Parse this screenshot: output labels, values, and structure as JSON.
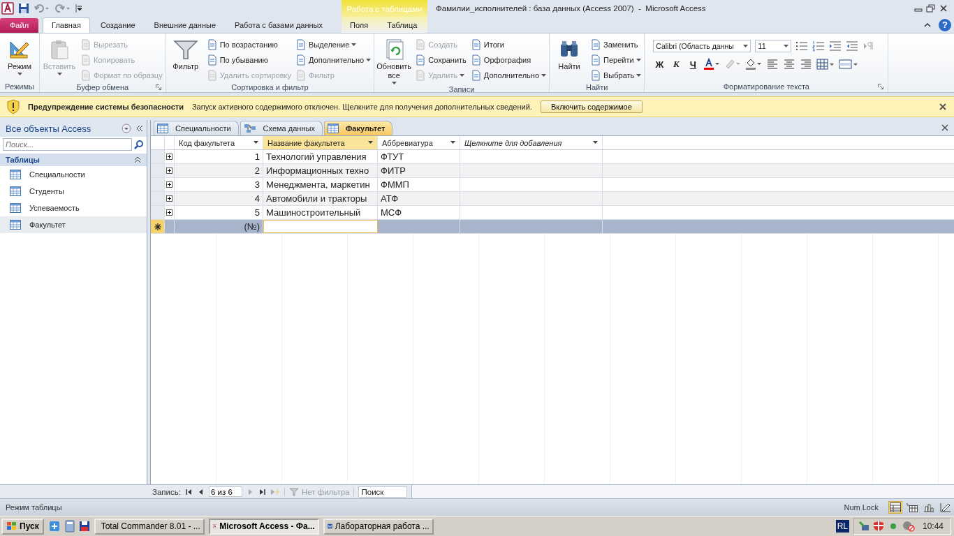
{
  "title_bar": {
    "contextual_group": "Работа с таблицами",
    "title": "Фамилии_исполнителей : база данных (Access 2007)  -  Microsoft Access"
  },
  "ribbon_tabs": [
    {
      "label": "Файл",
      "kind": "file",
      "selected": false
    },
    {
      "label": "Главная",
      "kind": "normal",
      "selected": true
    },
    {
      "label": "Создание",
      "kind": "normal",
      "selected": false
    },
    {
      "label": "Внешние данные",
      "kind": "normal",
      "selected": false
    },
    {
      "label": "Работа с базами данных",
      "kind": "normal",
      "selected": false
    },
    {
      "label": "Поля",
      "kind": "contextual",
      "selected": false
    },
    {
      "label": "Таблица",
      "kind": "contextual",
      "selected": false
    }
  ],
  "help": "?",
  "ribbon_groups": [
    {
      "kind": "commands",
      "label": "Режимы",
      "launcher": false,
      "large": {
        "label": "Режим",
        "disabled": false,
        "dropdown": true
      }
    },
    {
      "kind": "commands",
      "label": "Буфер обмена",
      "launcher": true,
      "large": {
        "label": "Вставить",
        "disabled": true,
        "dropdown": true
      },
      "columns": [
        [
          {
            "label": "Вырезать",
            "disabled": true,
            "dropdown": false
          },
          {
            "label": "Копировать",
            "disabled": true,
            "dropdown": false
          },
          {
            "label": "Формат по образцу",
            "disabled": true,
            "dropdown": false
          }
        ]
      ]
    },
    {
      "kind": "commands",
      "label": "Сортировка и фильтр",
      "launcher": false,
      "large": {
        "label": "Фильтр",
        "disabled": false,
        "dropdown": false
      },
      "columns": [
        [
          {
            "label": "По возрастанию",
            "disabled": false,
            "dropdown": false
          },
          {
            "label": "По убыванию",
            "disabled": false,
            "dropdown": false
          },
          {
            "label": "Удалить сортировку",
            "disabled": true,
            "dropdown": false
          }
        ],
        [
          {
            "label": "Выделение",
            "disabled": false,
            "dropdown": true
          },
          {
            "label": "Дополнительно",
            "disabled": false,
            "dropdown": true
          },
          {
            "label": "Фильтр",
            "disabled": true,
            "dropdown": false
          }
        ]
      ]
    },
    {
      "kind": "commands",
      "label": "Записи",
      "launcher": false,
      "large": {
        "label": "Обновить все",
        "disabled": false,
        "dropdown": true
      },
      "columns": [
        [
          {
            "label": "Создать",
            "disabled": true,
            "dropdown": false
          },
          {
            "label": "Сохранить",
            "disabled": false,
            "dropdown": false
          },
          {
            "label": "Удалить",
            "disabled": true,
            "dropdown": true
          }
        ],
        [
          {
            "label": "Итоги",
            "disabled": false,
            "dropdown": false
          },
          {
            "label": "Орфография",
            "disabled": false,
            "dropdown": false
          },
          {
            "label": "Дополнительно",
            "disabled": false,
            "dropdown": true
          }
        ]
      ]
    },
    {
      "kind": "commands",
      "label": "Найти",
      "launcher": false,
      "large": {
        "label": "Найти",
        "disabled": false,
        "dropdown": false
      },
      "columns": [
        [
          {
            "label": "Заменить",
            "disabled": false,
            "dropdown": false
          },
          {
            "label": "Перейти",
            "disabled": false,
            "dropdown": true
          },
          {
            "label": "Выбрать",
            "disabled": false,
            "dropdown": true
          }
        ]
      ]
    },
    {
      "kind": "format",
      "label": "Форматирование текста",
      "launcher": true,
      "font": "Calibri (Область данны",
      "size": "11",
      "style_buttons": [
        "Ж",
        "К",
        "Ч"
      ]
    }
  ],
  "security_bar": {
    "title": "Предупреждение системы безопасности",
    "message": "Запуск активного содержимого отключен. Щелкните для получения дополнительных сведений.",
    "button": "Включить содержимое"
  },
  "nav_pane": {
    "title": "Все объекты Access",
    "search_placeholder": "Поиск...",
    "group": "Таблицы",
    "items": [
      {
        "label": "Специальности",
        "selected": false
      },
      {
        "label": "Студенты",
        "selected": false
      },
      {
        "label": "Успеваемость",
        "selected": false
      },
      {
        "label": "Факультет",
        "selected": true
      }
    ]
  },
  "document_tabs": [
    {
      "label": "Специальности",
      "kind": "table",
      "selected": false
    },
    {
      "label": "Схема данных",
      "kind": "relationships",
      "selected": false
    },
    {
      "label": "Факультет",
      "kind": "table",
      "selected": true
    }
  ],
  "table": {
    "columns": [
      {
        "label": "Код факультета",
        "kind": "field",
        "selected": false
      },
      {
        "label": "Название факультета",
        "kind": "field",
        "selected": true
      },
      {
        "label": "Аббревиатура",
        "kind": "field",
        "selected": false
      },
      {
        "label": "Щелкните для добавления",
        "kind": "add",
        "selected": false
      }
    ],
    "rows": [
      {
        "kind": "record",
        "current": false,
        "cells": [
          "1",
          "Технологий управления",
          "ФТУТ"
        ]
      },
      {
        "kind": "record",
        "current": false,
        "cells": [
          "2",
          "Информационных техно",
          "ФИТР"
        ]
      },
      {
        "kind": "record",
        "current": false,
        "cells": [
          "3",
          "Менеджмента, маркетин",
          "ФММП"
        ]
      },
      {
        "kind": "record",
        "current": false,
        "cells": [
          "4",
          "Автомобили и тракторы",
          "АТФ"
        ]
      },
      {
        "kind": "record",
        "current": false,
        "cells": [
          "5",
          "Машиностроительный",
          "МСФ"
        ]
      },
      {
        "kind": "new",
        "current": true,
        "cells": [
          "(№)"
        ]
      }
    ]
  },
  "record_nav": {
    "label": "Запись:",
    "position": "6 из 6",
    "filter": "Нет фильтра",
    "search_placeholder": "Поиск"
  },
  "status_bar": {
    "mode": "Режим таблицы",
    "num_lock": "Num Lock",
    "views": [
      {
        "kind": "datasheet",
        "selected": true
      },
      {
        "kind": "pivot_table",
        "selected": false
      },
      {
        "kind": "pivot_chart",
        "selected": false
      },
      {
        "kind": "design",
        "selected": false
      }
    ]
  },
  "taskbar": {
    "start": "Пуск",
    "tasks": [
      {
        "label": "Total Commander 8.01 - ...",
        "kind": "tc",
        "selected": false
      },
      {
        "label": "Microsoft Access - Фа...",
        "kind": "access",
        "selected": true
      },
      {
        "label": "Лабораторная работа ...",
        "kind": "word",
        "selected": false
      }
    ],
    "language": "RL",
    "clock": "10:44"
  }
}
